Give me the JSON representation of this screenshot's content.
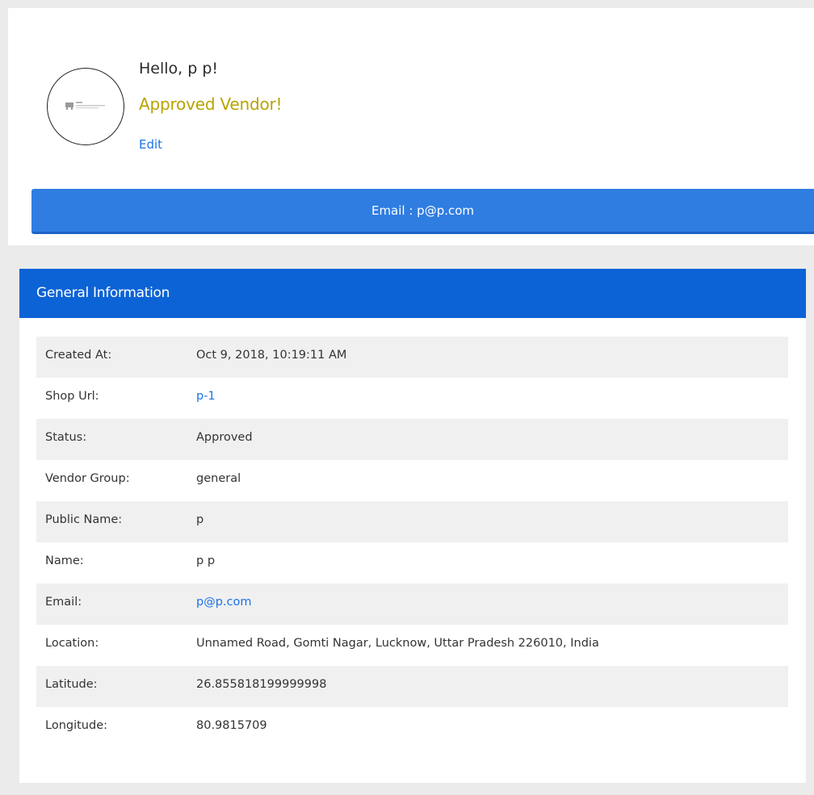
{
  "profile": {
    "greeting": "Hello, p p!",
    "status_title": "Approved Vendor!",
    "edit_label": "Edit",
    "email_button": "Email : p@p.com",
    "avatar_icon": "store-logo-icon"
  },
  "general_info": {
    "title": "General Information",
    "rows": [
      {
        "label": "Created At:",
        "value": "Oct 9, 2018, 10:19:11 AM",
        "link": false
      },
      {
        "label": "Shop Url:",
        "value": "p-1",
        "link": true
      },
      {
        "label": "Status:",
        "value": "Approved",
        "link": false
      },
      {
        "label": "Vendor Group:",
        "value": "general",
        "link": false
      },
      {
        "label": "Public Name:",
        "value": "p",
        "link": false
      },
      {
        "label": "Name:",
        "value": "p p",
        "link": false
      },
      {
        "label": "Email:",
        "value": "p@p.com",
        "link": true
      },
      {
        "label": "Location:",
        "value": "Unnamed Road, Gomti Nagar, Lucknow, Uttar Pradesh 226010, India",
        "link": false
      },
      {
        "label": "Latitude:",
        "value": "26.855818199999998",
        "link": false
      },
      {
        "label": "Longitude:",
        "value": "80.9815709",
        "link": false
      }
    ]
  },
  "colors": {
    "accent_blue": "#2f7de1",
    "header_blue": "#0c63d6",
    "approved_gold": "#b8a300",
    "link_blue": "#1a73e8"
  }
}
